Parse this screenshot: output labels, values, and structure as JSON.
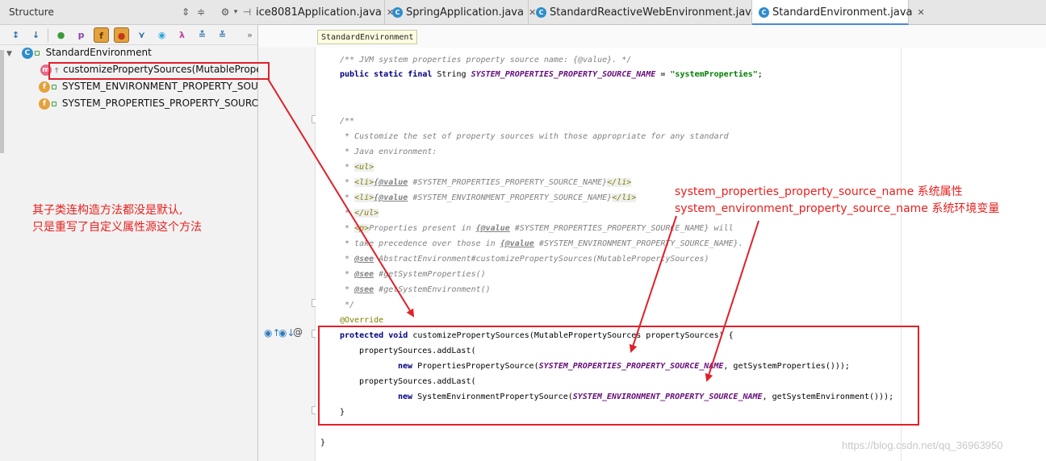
{
  "structure": {
    "title": "Structure",
    "tree": {
      "root": "StandardEnvironment",
      "items": [
        "customizePropertySources(MutablePrope",
        "SYSTEM_ENVIRONMENT_PROPERTY_SOU",
        "SYSTEM_PROPERTIES_PROPERTY_SOURC"
      ]
    }
  },
  "tabs": [
    {
      "label": "ice8081Application.java"
    },
    {
      "label": "SpringApplication.java"
    },
    {
      "label": "StandardReactiveWebEnvironment.java"
    },
    {
      "label": "StandardEnvironment.java",
      "active": true
    }
  ],
  "breadcrumb": "StandardEnvironment",
  "code": {
    "l1": "/** JVM system properties property source name: {@value}. */",
    "l2_kw": "public static final",
    "l2_type": " String ",
    "l2_const": "SYSTEM_PROPERTIES_PROPERTY_SOURCE_NAME",
    "l2_eq": " = ",
    "l2_str": "\"systemProperties\"",
    "l2_end": ";",
    "doc_open": "/**",
    "doc1": " * Customize the set of property sources with those appropriate for any standard",
    "doc2": " * Java environment:",
    "doc3": "<ul>",
    "doc4a": "<li>",
    "doc4b": "{@value",
    "doc4c": " #SYSTEM_PROPERTIES_PROPERTY_SOURCE_NAME}",
    "doc4d": "</li>",
    "doc5c": " #SYSTEM_ENVIRONMENT_PROPERTY_SOURCE_NAME}",
    "doc6": "</ul>",
    "doc7a": "<p>",
    "doc7b": "Properties present in ",
    "doc7c": " #SYSTEM_PROPERTIES_PROPERTY_SOURCE_NAME} will",
    "doc8a": " * take precedence over those in ",
    "doc8b": " #SYSTEM_ENVIRONMENT_PROPERTY_SOURCE_NAME}.",
    "see_tag": "@see",
    "see1": " AbstractEnvironment#customizePropertySources(MutablePropertySources)",
    "see2": " #getSystemProperties()",
    "see3": " #getSystemEnvironment()",
    "doc_close": " */",
    "override": "@Override",
    "m_kw": "protected void",
    "m_sig": " customizePropertySources(MutablePropertySources propertySources) {",
    "add": "propertySources.addLast(",
    "new_kw": "new",
    "p1a": " PropertiesPropertySource(",
    "p1b": "SYSTEM_PROPERTIES_PROPERTY_SOURCE_NAME",
    "p1c": ", getSystemProperties()));",
    "p2a": " SystemEnvironmentPropertySource(",
    "p2b": "SYSTEM_ENVIRONMENT_PROPERTY_SOURCE_NAME",
    "p2c": ", getSystemEnvironment()));",
    "brace_in": "}",
    "brace_out": "}"
  },
  "annotations": {
    "left_note_1": "其子类连构造方法都没是默认,",
    "left_note_2": "只是重写了自定义属性源这个方法",
    "right_note_1": "system_properties_property_source_name  系统属性",
    "right_note_2": "system_environment_property_source_name  系统环境变量"
  },
  "watermark": "https://blog.csdn.net/qq_36963950",
  "colors": {
    "annotation": "#e0202a",
    "keyword": "#000080",
    "constant": "#660e7a",
    "string": "#008000",
    "comment": "#808080"
  }
}
